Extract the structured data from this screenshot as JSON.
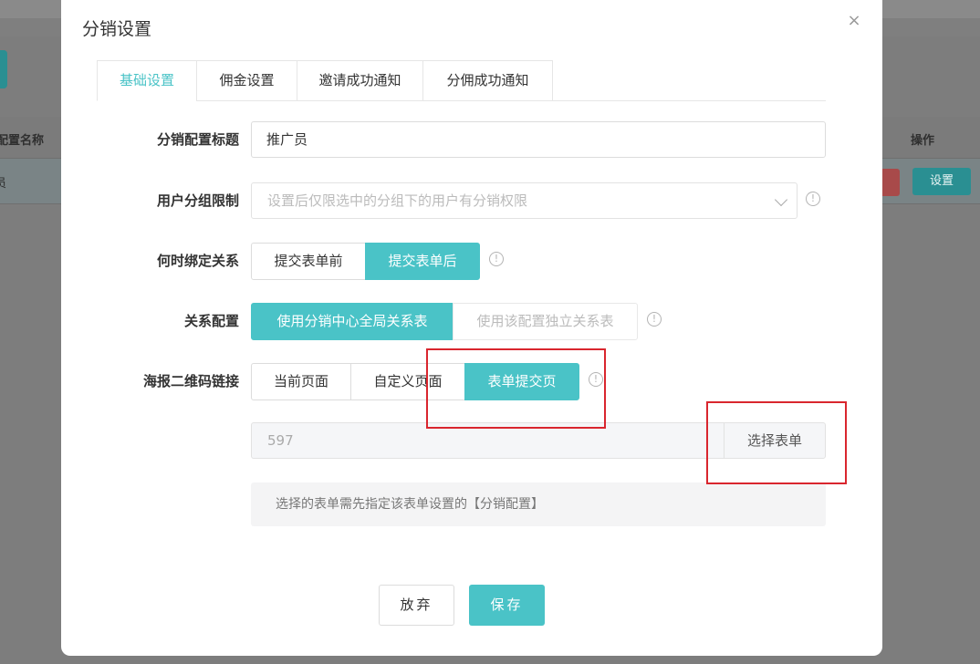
{
  "background": {
    "column_name_header": "配置名称",
    "column_action_header": "操作",
    "row_name_fragment": "员",
    "set_button_label": "设置"
  },
  "dialog": {
    "title": "分销设置",
    "close_label": "×",
    "tabs": [
      {
        "label": "基础设置",
        "active": true
      },
      {
        "label": "佣金设置",
        "active": false
      },
      {
        "label": "邀请成功通知",
        "active": false
      },
      {
        "label": "分佣成功通知",
        "active": false
      }
    ],
    "fields": {
      "config_title": {
        "label": "分销配置标题",
        "value": "推广员"
      },
      "user_group": {
        "label": "用户分组限制",
        "placeholder": "设置后仅限选中的分组下的用户有分销权限"
      },
      "bind_time": {
        "label": "何时绑定关系",
        "options": [
          "提交表单前",
          "提交表单后"
        ],
        "selected": "提交表单后"
      },
      "relation_config": {
        "label": "关系配置",
        "options": [
          "使用分销中心全局关系表",
          "使用该配置独立关系表"
        ],
        "selected": "使用分销中心全局关系表"
      },
      "poster_link": {
        "label": "海报二维码链接",
        "options": [
          "当前页面",
          "自定义页面",
          "表单提交页"
        ],
        "selected": "表单提交页"
      },
      "form_id": {
        "value": "597",
        "choose_label": "选择表单"
      },
      "hint": "选择的表单需先指定该表单设置的【分销配置】"
    },
    "info_icon": "ⓘ",
    "footer": {
      "cancel_label": "放弃",
      "save_label": "保存"
    }
  },
  "colors": {
    "accent": "#4ac3c7",
    "annotation_red": "#d9262e"
  }
}
